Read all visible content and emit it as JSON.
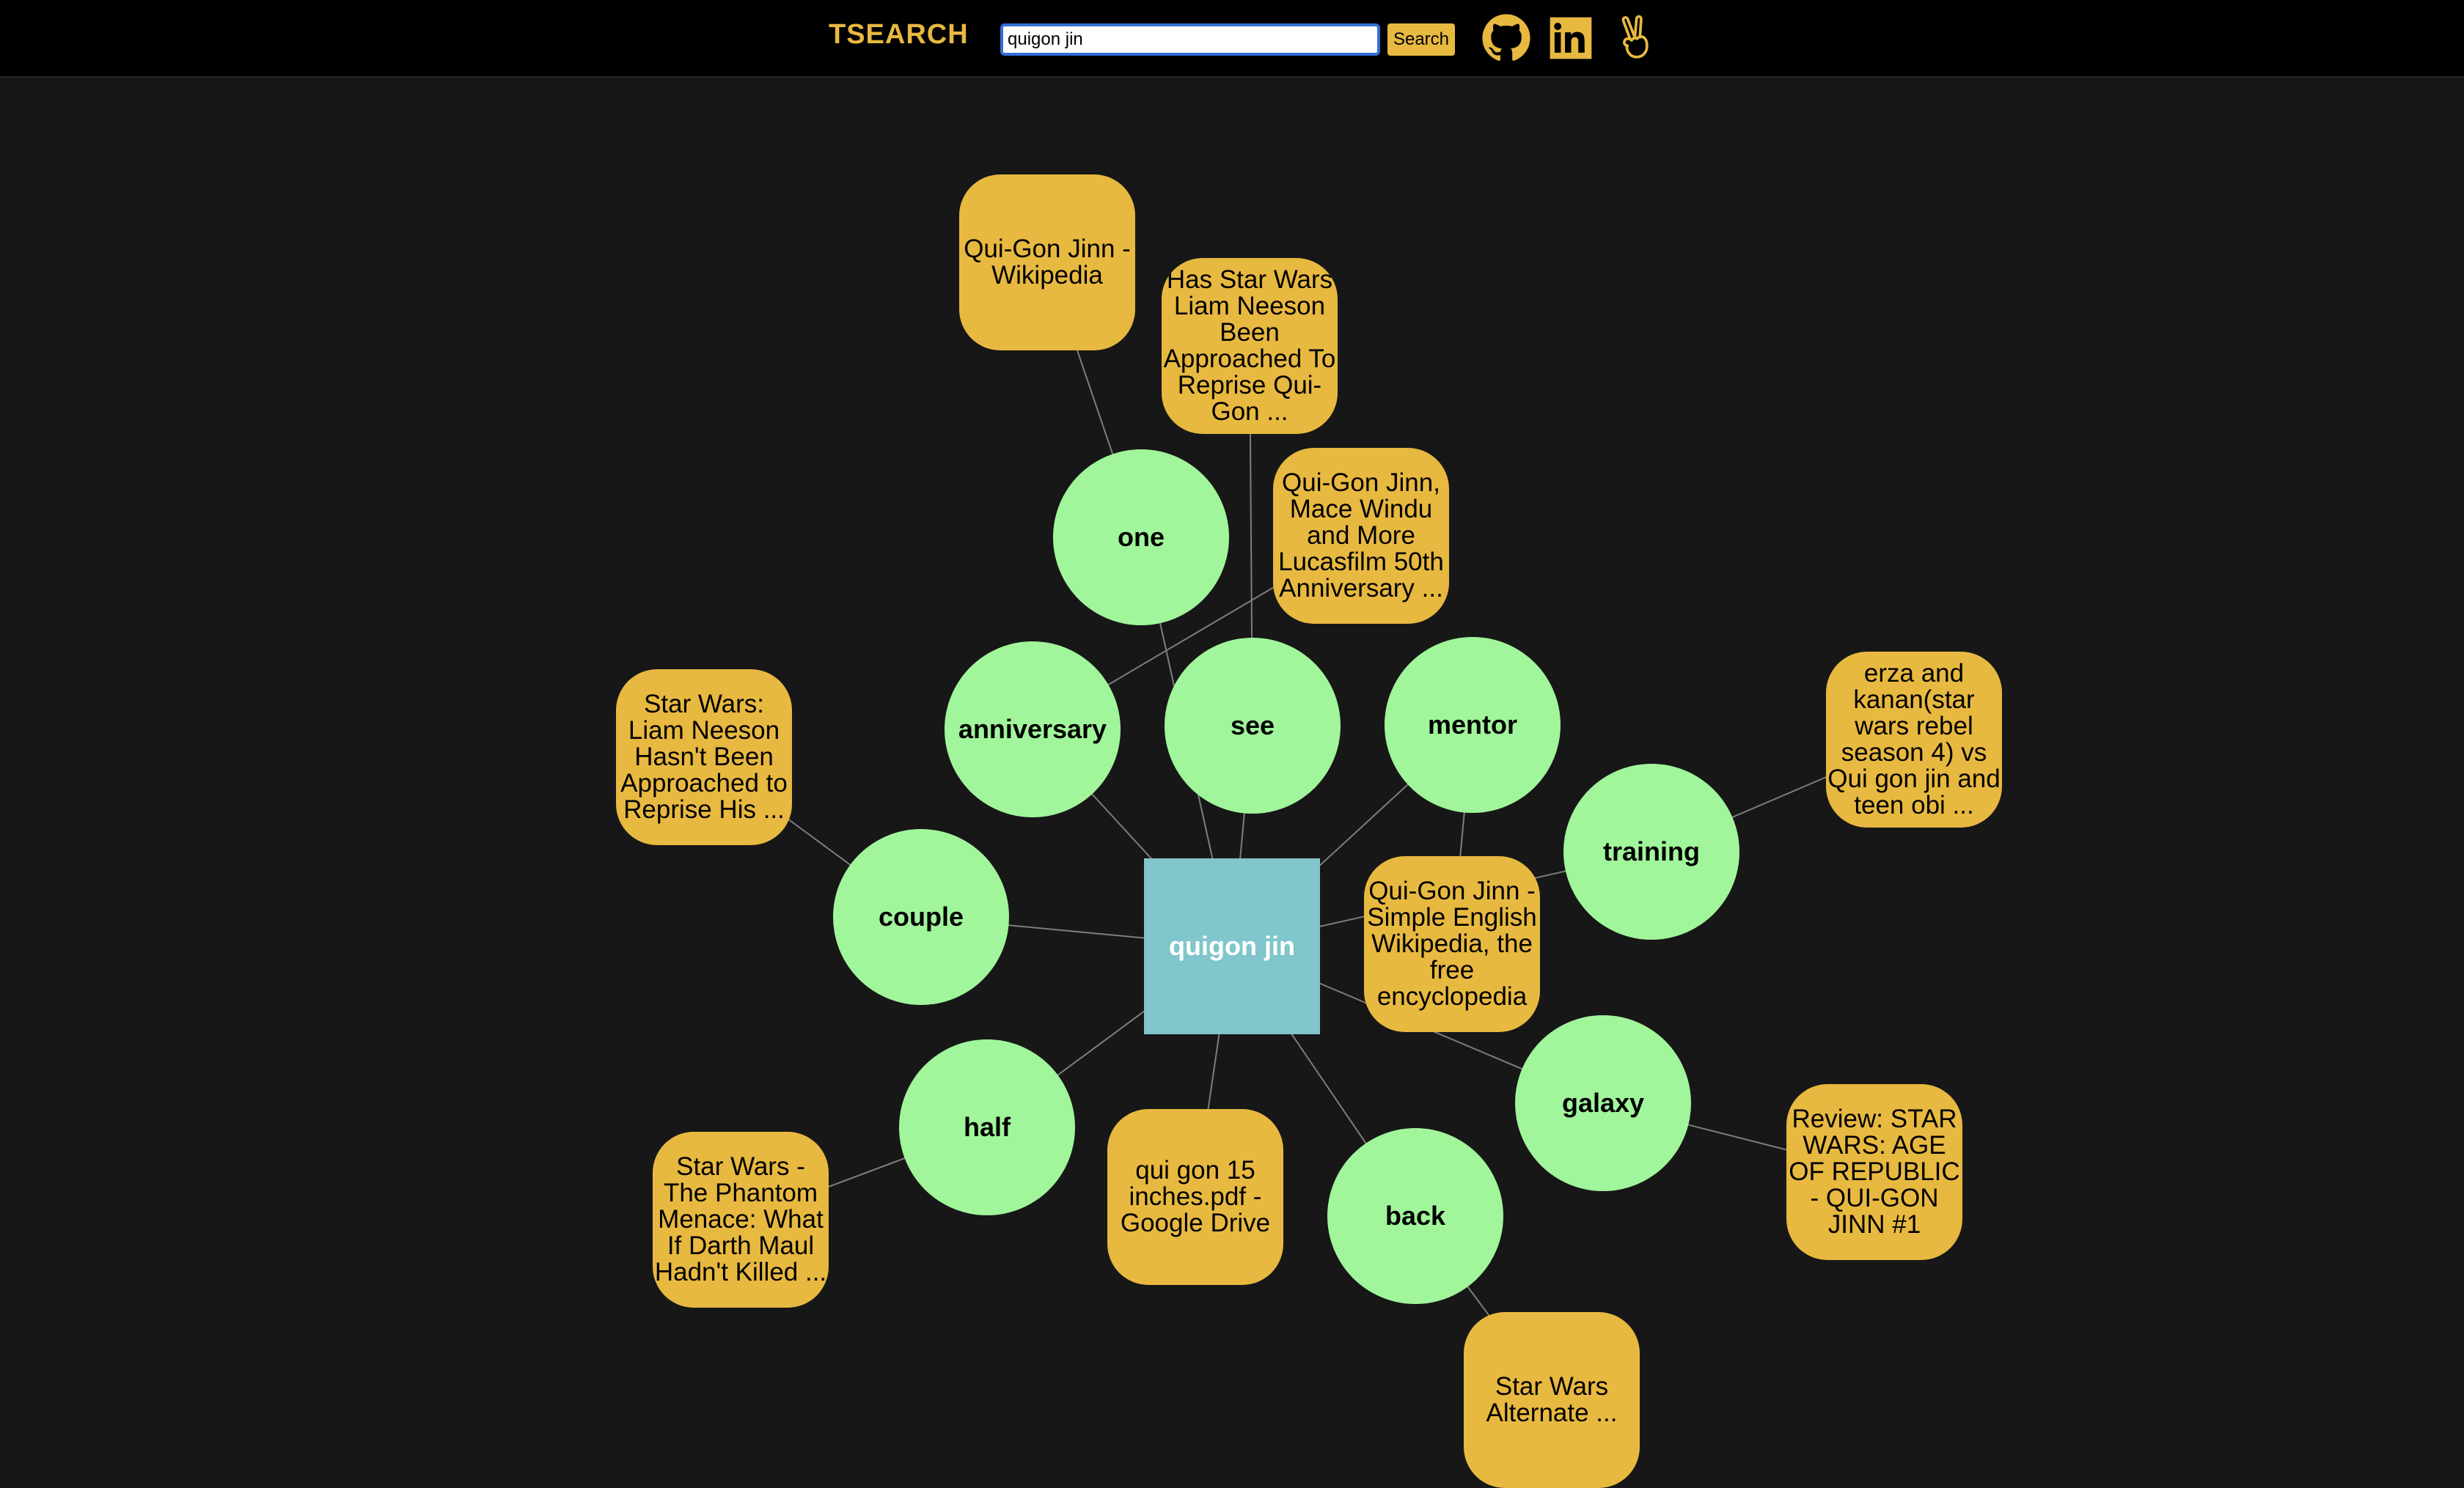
{
  "header": {
    "brand": "TSEARCH",
    "search": {
      "value": "quigon jin",
      "button_label": "Search"
    },
    "icons": [
      "github-icon",
      "linkedin-icon",
      "peace-hand-icon"
    ]
  },
  "colors": {
    "accent": "#e8b940",
    "term_node": "#a1f59b",
    "center_node": "#80c6cc",
    "background": "#171717"
  },
  "graph": {
    "center": {
      "label": "quigon jin"
    },
    "terms": [
      {
        "id": "one",
        "label": "one"
      },
      {
        "id": "anniversary",
        "label": "anniversary"
      },
      {
        "id": "see",
        "label": "see"
      },
      {
        "id": "mentor",
        "label": "mentor"
      },
      {
        "id": "training",
        "label": "training"
      },
      {
        "id": "couple",
        "label": "couple"
      },
      {
        "id": "half",
        "label": "half"
      },
      {
        "id": "galaxy",
        "label": "galaxy"
      },
      {
        "id": "back",
        "label": "back"
      }
    ],
    "docs": [
      {
        "id": "d1",
        "label": "Qui-Gon Jinn - Wikipedia",
        "term": "one"
      },
      {
        "id": "d2",
        "label": "Has Star Wars Liam Neeson Been Approached To Reprise Qui-Gon ...",
        "term": "see"
      },
      {
        "id": "d3",
        "label": "Qui-Gon Jinn, Mace Windu and More Lucasfilm 50th Anniversary ...",
        "term": "anniversary"
      },
      {
        "id": "d4",
        "label": "Star Wars: Liam Neeson Hasn't Been Approached to Reprise His ...",
        "term": "couple"
      },
      {
        "id": "d5",
        "label": "erza and kanan(star wars rebel season 4) vs Qui gon jin and teen obi ...",
        "term": "training"
      },
      {
        "id": "d6",
        "label": "Qui-Gon Jinn - Simple English Wikipedia, the free encyclopedia",
        "term": "mentor"
      },
      {
        "id": "d7",
        "label": "Star Wars - The Phantom Menace: What If Darth Maul Hadn't Killed ...",
        "term": "half"
      },
      {
        "id": "d8",
        "label": "qui gon 15 inches.pdf - Google Drive",
        "term": "center"
      },
      {
        "id": "d9",
        "label": "Review: STAR WARS: AGE OF REPUBLIC - QUI-GON JINN #1",
        "term": "galaxy"
      },
      {
        "id": "d10",
        "label": "Star Wars Alternate ...",
        "term": "back"
      }
    ]
  }
}
